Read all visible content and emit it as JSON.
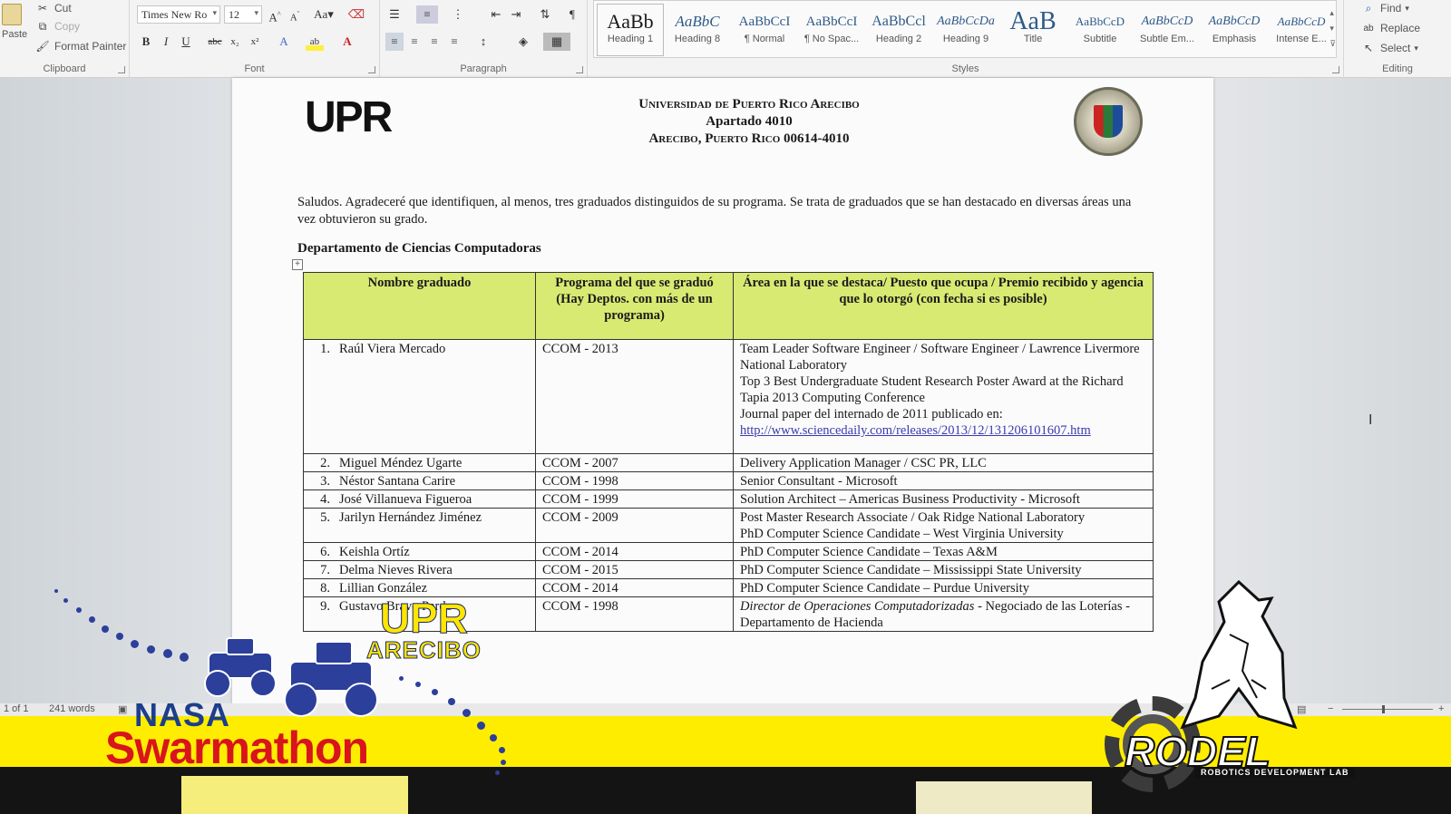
{
  "ribbon": {
    "clipboard": {
      "paste": "Paste",
      "cut": "Cut",
      "copy": "Copy",
      "format_painter": "Format Painter",
      "label": "Clipboard"
    },
    "font": {
      "name": "Times New Ro",
      "size": "12",
      "label": "Font",
      "change_case": "Aa"
    },
    "paragraph": {
      "label": "Paragraph"
    },
    "styles": {
      "label": "Styles",
      "items": [
        {
          "preview": "AaBb",
          "name": "Heading 1"
        },
        {
          "preview": "AaBbC",
          "name": "Heading 8"
        },
        {
          "preview": "AaBbCcI",
          "name": "¶ Normal"
        },
        {
          "preview": "AaBbCcI",
          "name": "¶ No Spac..."
        },
        {
          "preview": "AaBbCcl",
          "name": "Heading 2"
        },
        {
          "preview": "AaBbCcDa",
          "name": "Heading 9"
        },
        {
          "preview": "AaB",
          "name": "Title"
        },
        {
          "preview": "AaBbCcD",
          "name": "Subtitle"
        },
        {
          "preview": "AaBbCcD",
          "name": "Subtle Em..."
        },
        {
          "preview": "AaBbCcD",
          "name": "Emphasis"
        },
        {
          "preview": "AaBbCcD",
          "name": "Intense E..."
        }
      ]
    },
    "editing": {
      "find": "Find",
      "replace": "Replace",
      "select": "Select",
      "label": "Editing"
    }
  },
  "document": {
    "logo_text": "UPR",
    "header": [
      "Universidad de Puerto Rico Arecibo",
      "Apartado 4010",
      "Arecibo, Puerto Rico 00614-4010"
    ],
    "intro": "Saludos. Agradeceré que identifiquen, al menos, tres graduados distinguidos de su programa. Se trata de graduados que se han destacado en diversas áreas una vez obtuvieron su grado.",
    "department": "Departamento de Ciencias Computadoras",
    "table": {
      "headers": [
        "Nombre graduado",
        "Programa del que se graduó (Hay Deptos. con más de un programa)",
        "Área en la que se destaca/ Puesto que ocupa / Premio recibido y agencia que lo otorgó (con fecha si es posible)"
      ],
      "rows": [
        {
          "num": "1.",
          "name": "Raúl Viera Mercado",
          "program": "CCOM - 2013",
          "area": [
            "Team Leader Software Engineer / Software Engineer / Lawrence Livermore National Laboratory",
            "Top 3 Best Undergraduate Student Research Poster Award at the Richard Tapia 2013 Computing Conference",
            "Journal paper del internado de 2011 publicado en:"
          ],
          "link": "http://www.sciencedaily.com/releases/2013/12/131206101607.htm"
        },
        {
          "num": "2.",
          "name": "Miguel Méndez Ugarte",
          "program": "CCOM - 2007",
          "area": [
            "Delivery Application Manager / CSC PR, LLC"
          ]
        },
        {
          "num": "3.",
          "name": "Néstor Santana Carire",
          "program": "CCOM - 1998",
          "area": [
            "Senior Consultant - Microsoft"
          ]
        },
        {
          "num": "4.",
          "name": "José Villanueva  Figueroa",
          "program": "CCOM - 1999",
          "area": [
            "Solution Architect – Americas Business Productivity - Microsoft"
          ]
        },
        {
          "num": "5.",
          "name": "Jarilyn Hernández Jiménez",
          "program": "CCOM - 2009",
          "area": [
            "Post Master Research Associate / Oak Ridge National Laboratory",
            "PhD Computer Science Candidate – West Virginia University"
          ]
        },
        {
          "num": "6.",
          "name": "Keishla Ortíz",
          "program": "CCOM - 2014",
          "area": [
            "PhD Computer Science Candidate – Texas A&M"
          ]
        },
        {
          "num": "7.",
          "name": "Delma Nieves Rivera",
          "program": "CCOM - 2015",
          "area": [
            "PhD Computer Science Candidate – Mississippi State University"
          ]
        },
        {
          "num": "8.",
          "name": "Lillian González",
          "program": "CCOM - 2014",
          "area": [
            "PhD Computer Science Candidate – Purdue University"
          ]
        },
        {
          "num": "9.",
          "name": "Gustavo Bravo Pardo",
          "program": "CCOM - 1998",
          "area_italic": "Director de Operaciones Computadorizadas",
          "area_rest": " - Negociado de las Loterías - Departamento de Hacienda"
        }
      ]
    }
  },
  "statusbar": {
    "page": "1 of 1",
    "words": "241 words"
  },
  "overlay": {
    "nasa": "NASA",
    "swarmathon": "Swarmathon",
    "upr": "UPR",
    "arecibo": "ARECIBO",
    "rodel": "RODEL",
    "rodel_sub": "ROBOTICS DEVELOPMENT LAB"
  },
  "colors": {
    "table_header": "#d9ea73",
    "band": "#ffed00",
    "link": "#3a3ab0"
  }
}
